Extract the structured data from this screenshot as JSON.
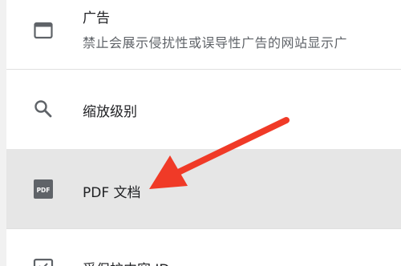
{
  "settings": {
    "ads": {
      "title": "广告",
      "subtitle": "禁止会展示侵扰性或误导性广告的网站显示广",
      "icon": "ads-window-icon"
    },
    "zoom": {
      "title": "缩放级别",
      "icon": "search-icon"
    },
    "pdf": {
      "title": "PDF 文档",
      "icon": "pdf-icon",
      "icon_text": "PDF"
    },
    "protected_content": {
      "title": "受保护内容 ID",
      "icon": "protected-content-icon"
    }
  },
  "colors": {
    "highlight_row": "#e6e6e6",
    "annotation_arrow": "#f03a27",
    "icon": "#5f6368"
  }
}
